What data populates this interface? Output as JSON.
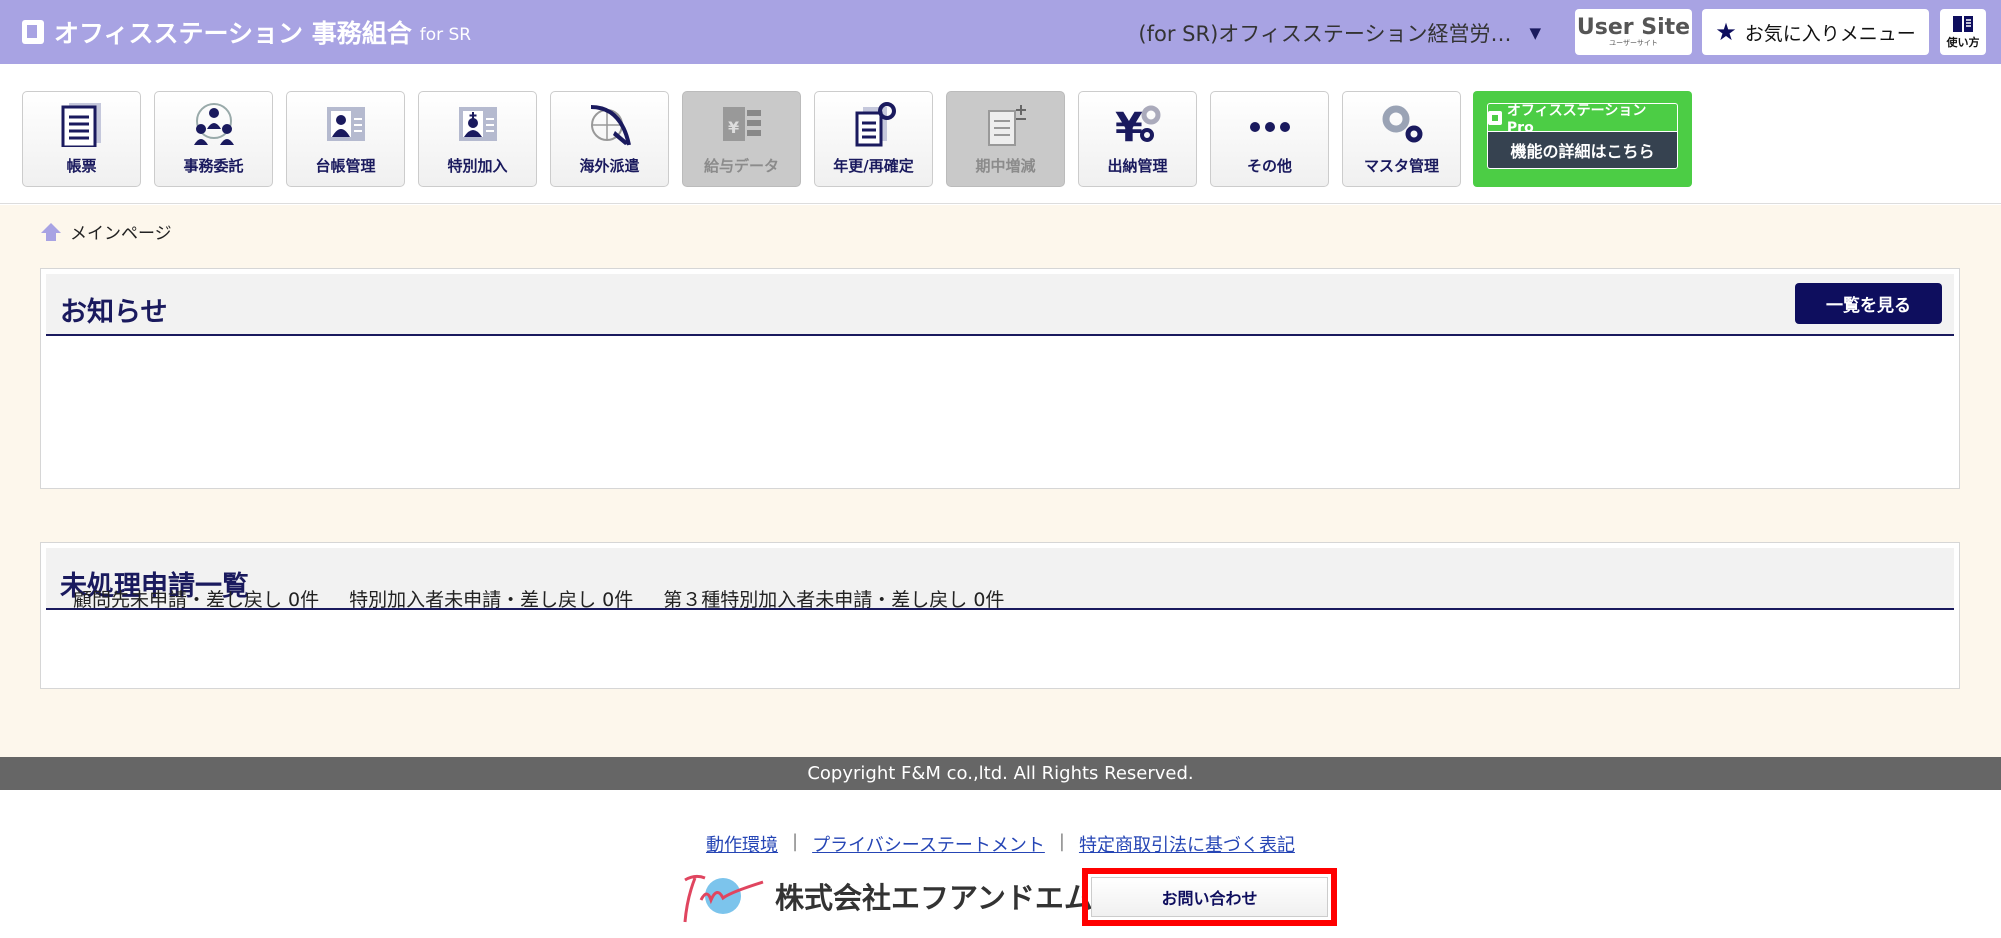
{
  "header": {
    "app_title": "オフィスステーション 事務組合",
    "app_suffix": "for SR",
    "org_selector": "(for SR)オフィスステーション経営労…",
    "user_site": "User Site",
    "user_site_sub": "ユーザーサイト",
    "favorites": "お気に入りメニュー",
    "help": "使い方"
  },
  "menu": [
    {
      "label": "帳票",
      "enabled": true
    },
    {
      "label": "事務委託",
      "enabled": true
    },
    {
      "label": "台帳管理",
      "enabled": true
    },
    {
      "label": "特別加入",
      "enabled": true
    },
    {
      "label": "海外派遣",
      "enabled": true
    },
    {
      "label": "給与データ",
      "enabled": false
    },
    {
      "label": "年更/再確定",
      "enabled": true
    },
    {
      "label": "期中増減",
      "enabled": false
    },
    {
      "label": "出納管理",
      "enabled": true
    },
    {
      "label": "その他",
      "enabled": true
    },
    {
      "label": "マスタ管理",
      "enabled": true
    }
  ],
  "pro": {
    "brand": "オフィスステーション Pro",
    "details": "機能の詳細はこちら"
  },
  "breadcrumb": "メインページ",
  "notices": {
    "title": "お知らせ",
    "view_all": "一覧を見る"
  },
  "pending": {
    "title": "未処理申請一覧",
    "items": [
      "顧問先未申請・差し戻し 0件",
      "特別加入者未申請・差し戻し 0件",
      "第３種特別加入者未申請・差し戻し 0件"
    ]
  },
  "footer": {
    "copyright": "Copyright F&M co.,ltd. All Rights Reserved.",
    "links": [
      "動作環境",
      "プライバシーステートメント",
      "特定商取引法に基づく表記"
    ],
    "company": "株式会社エフアンドエム",
    "contact": "お問い合わせ"
  },
  "colors": {
    "header": "#a8a3e3",
    "navy": "#1a1a5e",
    "pro_green": "#4ccd45",
    "highlight": "#ff0000"
  }
}
